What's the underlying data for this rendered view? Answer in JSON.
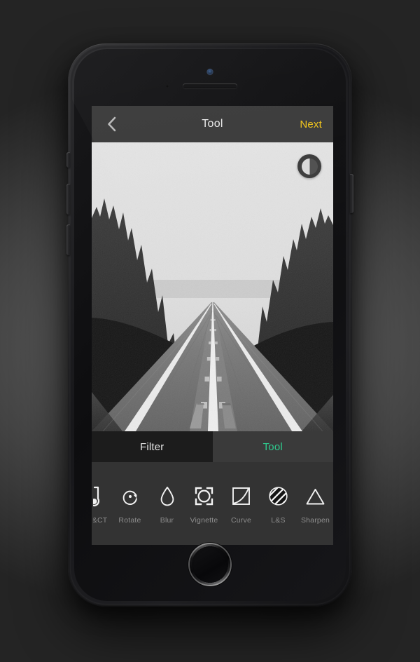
{
  "app": {
    "header": {
      "back_icon": "chevron-left-icon",
      "title": "Tool",
      "next_label": "Next"
    },
    "photo": {
      "description": "Black and white photograph of a straight two-lane highway receding to a vanishing point, lined by dense coniferous forest under a bright overcast sky",
      "compare_icon": "contrast-circle-icon"
    },
    "tabs": [
      {
        "label": "Filter",
        "active": false
      },
      {
        "label": "Tool",
        "active": true
      }
    ],
    "tools": [
      {
        "label": "B&CT",
        "icon": "brightness-contrast-icon",
        "clipped": true
      },
      {
        "label": "Rotate",
        "icon": "rotate-icon"
      },
      {
        "label": "Blur",
        "icon": "droplet-blur-icon"
      },
      {
        "label": "Vignette",
        "icon": "vignette-brackets-icon"
      },
      {
        "label": "Curve",
        "icon": "tone-curve-icon"
      },
      {
        "label": "L&S",
        "icon": "light-shadow-icon"
      },
      {
        "label": "Sharpen",
        "icon": "sharpen-triangle-icon"
      }
    ],
    "colors": {
      "accent_next": "#f0c419",
      "accent_tab_active": "#2ecc8f",
      "appbar_bg": "#3a3a3a",
      "tab_inactive_bg": "#1c1c1c",
      "tools_bg": "#333333",
      "tool_label": "#8e8e8e"
    }
  },
  "device": {
    "speaker": "earpiece-speaker",
    "camera": "front-camera",
    "sensor": "proximity-sensor",
    "home_button": "home-button",
    "side_buttons": [
      "mute-switch",
      "volume-up-button",
      "volume-down-button",
      "power-button"
    ]
  }
}
